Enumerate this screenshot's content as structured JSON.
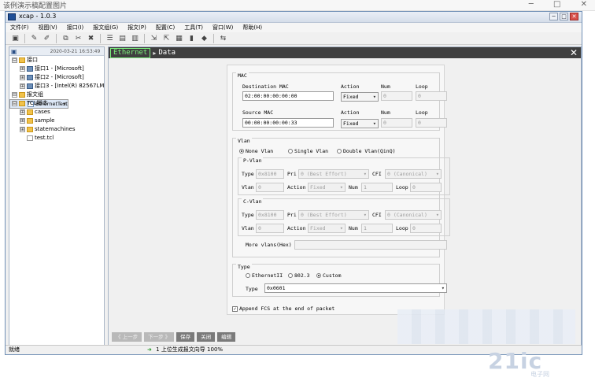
{
  "top_strip": {
    "title": "该例演示稿配置图片",
    "controls": [
      "─",
      "□",
      "✕"
    ]
  },
  "window": {
    "title": "xcap - 1.0.3",
    "controls": [
      "─",
      "□",
      "✕"
    ]
  },
  "menu": [
    "文件(F)",
    "视图(V)",
    "接口(I)",
    "报文组(G)",
    "报文(P)",
    "配置(C)",
    "工具(T)",
    "窗口(W)",
    "帮助(H)"
  ],
  "toolbar_icons": [
    "new-icon",
    "edit-icon",
    "brush-icon",
    "copy-icon",
    "cut-icon",
    "delete-icon",
    "list-icon",
    "save-icon",
    "save-as-icon",
    "import-icon",
    "export-icon",
    "chart-icon",
    "bar-chart-icon",
    "package-icon",
    "link-icon"
  ],
  "sidebar": {
    "timestamp": "2020-03-21 16:53:49",
    "tree": [
      {
        "label": "接口",
        "level": 0,
        "expander": "⊟",
        "icon": "folder"
      },
      {
        "label": "接口1 - [Microsoft]",
        "level": 1,
        "expander": "⊞",
        "icon": "net"
      },
      {
        "label": "接口2 - [Microsoft]",
        "level": 1,
        "expander": "⊞",
        "icon": "net"
      },
      {
        "label": "接口3 - [Intel(R) 82567LM",
        "level": 1,
        "expander": "⊞",
        "icon": "net"
      },
      {
        "label": "报文组",
        "level": 0,
        "expander": "⊟",
        "icon": "folder"
      },
      {
        "label": "EthernetTest",
        "level": 1,
        "expander": "",
        "icon": "doc"
      },
      {
        "label": "TCL脚本",
        "level": 0,
        "expander": "⊟",
        "icon": "folder"
      },
      {
        "label": "cases",
        "level": 1,
        "expander": "⊞",
        "icon": "folder"
      },
      {
        "label": "sample",
        "level": 1,
        "expander": "⊞",
        "icon": "folder"
      },
      {
        "label": "statemachines",
        "level": 1,
        "expander": "⊞",
        "icon": "folder"
      },
      {
        "label": "test.tcl",
        "level": 1,
        "expander": "",
        "icon": "file"
      }
    ]
  },
  "main": {
    "tab": "Ethernet",
    "crumb": "Data",
    "close": "✕"
  },
  "form": {
    "mac": {
      "title": "MAC",
      "dst_label": "Destination MAC",
      "dst_value": "02:00:00:00:00:00",
      "src_label": "Source MAC",
      "src_value": "00:00:00:00:00:33",
      "action_label": "Action",
      "num_label": "Num",
      "loop_label": "Loop",
      "dst_action": "Fixed",
      "dst_num": "0",
      "dst_loop": "0",
      "src_action": "Fixed",
      "src_num": "0",
      "src_loop": "0"
    },
    "vlan": {
      "title": "Vlan",
      "opt_none": "None Vlan",
      "opt_single": "Single Vlan",
      "opt_double": "Double Vlan(QinQ)",
      "selected": "None Vlan",
      "p_title": "P-Vlan",
      "c_title": "C-Vlan",
      "type_label": "Type",
      "pri_label": "Pri",
      "cfi_label": "CFI",
      "vlan_label": "Vlan",
      "action_label": "Action",
      "num_label": "Num",
      "loop_label": "Loop",
      "p": {
        "type": "0x8100",
        "pri": "0 (Best Effort)",
        "cfi": "0 (Canonical)",
        "vlan": "0",
        "action": "Fixed",
        "num": "1",
        "loop": "0"
      },
      "c": {
        "type": "0x8100",
        "pri": "0 (Best Effort)",
        "cfi": "0 (Canonical)",
        "vlan": "0",
        "action": "Fixed",
        "num": "1",
        "loop": "0"
      },
      "more_label": "More vlans(Hex)",
      "more_value": ""
    },
    "type": {
      "title": "Type",
      "opt_eth2": "EthernetII",
      "opt_8023": "802.3",
      "opt_custom": "Custom",
      "selected": "Custom",
      "type_label": "Type",
      "type_value": "0x0601"
    },
    "append_fcs": {
      "label": "Append FCS at the end of packet",
      "checked": true
    }
  },
  "buttons": [
    {
      "label": "《 上一步",
      "enabled": false
    },
    {
      "label": "下一步 》",
      "enabled": false
    },
    {
      "label": "保存",
      "enabled": true
    },
    {
      "label": "关闭",
      "enabled": true
    },
    {
      "label": "编辑",
      "enabled": true
    }
  ],
  "status": {
    "left": "就绪",
    "arrow": "➜",
    "count": "1",
    "message": "上位生成报文向导 100%"
  },
  "watermark": {
    "main": "21ic",
    "sub": "电子网"
  }
}
